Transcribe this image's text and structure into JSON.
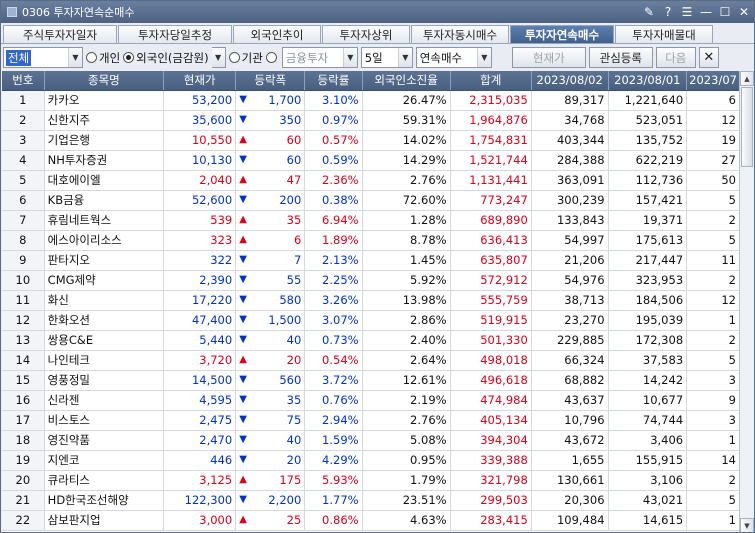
{
  "window": {
    "title": "0306 투자자연속순매수",
    "buttons": [
      "✎",
      "?",
      "☰",
      "—",
      "☐",
      "✕"
    ]
  },
  "tabs": [
    {
      "label": "주식투자자일자",
      "w": 114
    },
    {
      "label": "투자자당일추정",
      "w": 114
    },
    {
      "label": "외국인추이",
      "w": 88
    },
    {
      "label": "투자자상위",
      "w": 88
    },
    {
      "label": "투자자동시매수",
      "w": 98
    },
    {
      "label": "투자자연속매수",
      "w": 104,
      "active": true
    },
    {
      "label": "투자자매물대",
      "w": 98
    }
  ],
  "toolbar": {
    "market": "전체",
    "radio_individual": "개인",
    "radio_foreign": "외국인(금감원)",
    "radio_institution": "기관",
    "institution_type": "금융투자",
    "period": "5일",
    "mode": "연속매수",
    "current_price_btn": "현재가",
    "watchlist_btn": "관심등록",
    "next_btn": "다음",
    "close_icon": "✕"
  },
  "columns": [
    "번호",
    "종목명",
    "현재가",
    "등락폭",
    "등락률",
    "외국인소진율",
    "합계",
    "2023/08/02",
    "2023/08/01",
    "2023/07"
  ],
  "rows": [
    {
      "no": "1",
      "name": "카카오",
      "price": "53,200",
      "dir": "down",
      "chg": "1,700",
      "rate": "3.10%",
      "exh": "26.47%",
      "sum": "2,315,035",
      "d1": "89,317",
      "d2": "1,221,640",
      "d3": "6"
    },
    {
      "no": "2",
      "name": "신한지주",
      "price": "35,600",
      "dir": "down",
      "chg": "350",
      "rate": "0.97%",
      "exh": "59.31%",
      "sum": "1,964,876",
      "d1": "34,768",
      "d2": "523,051",
      "d3": "12"
    },
    {
      "no": "3",
      "name": "기업은행",
      "price": "10,550",
      "dir": "up",
      "chg": "60",
      "rate": "0.57%",
      "exh": "14.02%",
      "sum": "1,754,831",
      "d1": "403,344",
      "d2": "135,752",
      "d3": "19"
    },
    {
      "no": "4",
      "name": "NH투자증권",
      "price": "10,130",
      "dir": "down",
      "chg": "60",
      "rate": "0.59%",
      "exh": "14.29%",
      "sum": "1,521,744",
      "d1": "284,388",
      "d2": "622,219",
      "d3": "27"
    },
    {
      "no": "5",
      "name": "대호에이엘",
      "price": "2,040",
      "dir": "up",
      "chg": "47",
      "rate": "2.36%",
      "exh": "2.76%",
      "sum": "1,131,441",
      "d1": "363,091",
      "d2": "112,736",
      "d3": "50"
    },
    {
      "no": "6",
      "name": "KB금융",
      "price": "52,600",
      "dir": "down",
      "chg": "200",
      "rate": "0.38%",
      "exh": "72.60%",
      "sum": "773,247",
      "d1": "300,239",
      "d2": "157,421",
      "d3": "5"
    },
    {
      "no": "7",
      "name": "휴림네트웍스",
      "price": "539",
      "dir": "up",
      "chg": "35",
      "rate": "6.94%",
      "exh": "1.28%",
      "sum": "689,890",
      "d1": "133,843",
      "d2": "19,371",
      "d3": "2"
    },
    {
      "no": "8",
      "name": "에스아이리소스",
      "price": "323",
      "dir": "up",
      "chg": "6",
      "rate": "1.89%",
      "exh": "8.78%",
      "sum": "636,413",
      "d1": "54,997",
      "d2": "175,613",
      "d3": "5"
    },
    {
      "no": "9",
      "name": "판타지오",
      "price": "322",
      "dir": "down",
      "chg": "7",
      "rate": "2.13%",
      "exh": "1.45%",
      "sum": "635,807",
      "d1": "21,206",
      "d2": "217,447",
      "d3": "11"
    },
    {
      "no": "10",
      "name": "CMG제약",
      "price": "2,390",
      "dir": "down",
      "chg": "55",
      "rate": "2.25%",
      "exh": "5.92%",
      "sum": "572,912",
      "d1": "54,976",
      "d2": "323,953",
      "d3": "2"
    },
    {
      "no": "11",
      "name": "화신",
      "price": "17,220",
      "dir": "down",
      "chg": "580",
      "rate": "3.26%",
      "exh": "13.98%",
      "sum": "555,759",
      "d1": "38,713",
      "d2": "184,506",
      "d3": "12"
    },
    {
      "no": "12",
      "name": "한화오션",
      "price": "47,400",
      "dir": "down",
      "chg": "1,500",
      "rate": "3.07%",
      "exh": "2.86%",
      "sum": "519,915",
      "d1": "23,270",
      "d2": "195,039",
      "d3": "1"
    },
    {
      "no": "13",
      "name": "쌍용C&E",
      "price": "5,440",
      "dir": "down",
      "chg": "40",
      "rate": "0.73%",
      "exh": "2.40%",
      "sum": "501,330",
      "d1": "229,885",
      "d2": "172,308",
      "d3": "2"
    },
    {
      "no": "14",
      "name": "나인테크",
      "price": "3,720",
      "dir": "up",
      "chg": "20",
      "rate": "0.54%",
      "exh": "2.64%",
      "sum": "498,018",
      "d1": "66,324",
      "d2": "37,583",
      "d3": "5"
    },
    {
      "no": "15",
      "name": "영풍정밀",
      "price": "14,500",
      "dir": "down",
      "chg": "560",
      "rate": "3.72%",
      "exh": "12.61%",
      "sum": "496,618",
      "d1": "68,882",
      "d2": "14,242",
      "d3": "3"
    },
    {
      "no": "16",
      "name": "신라젠",
      "price": "4,595",
      "dir": "down",
      "chg": "35",
      "rate": "0.76%",
      "exh": "2.19%",
      "sum": "474,984",
      "d1": "43,637",
      "d2": "10,677",
      "d3": "9"
    },
    {
      "no": "17",
      "name": "비스토스",
      "price": "2,475",
      "dir": "down",
      "chg": "75",
      "rate": "2.94%",
      "exh": "2.76%",
      "sum": "405,134",
      "d1": "10,796",
      "d2": "74,744",
      "d3": "3"
    },
    {
      "no": "18",
      "name": "영진약품",
      "price": "2,470",
      "dir": "down",
      "chg": "40",
      "rate": "1.59%",
      "exh": "5.08%",
      "sum": "394,304",
      "d1": "43,672",
      "d2": "3,406",
      "d3": "1"
    },
    {
      "no": "19",
      "name": "지엔코",
      "price": "446",
      "dir": "down",
      "chg": "20",
      "rate": "4.29%",
      "exh": "0.95%",
      "sum": "339,388",
      "d1": "1,655",
      "d2": "155,915",
      "d3": "14"
    },
    {
      "no": "20",
      "name": "큐라티스",
      "price": "3,125",
      "dir": "up",
      "chg": "175",
      "rate": "5.93%",
      "exh": "1.79%",
      "sum": "321,798",
      "d1": "130,661",
      "d2": "3,106",
      "d3": "2"
    },
    {
      "no": "21",
      "name": "HD한국조선해양",
      "price": "122,300",
      "dir": "down",
      "chg": "2,200",
      "rate": "1.77%",
      "exh": "23.51%",
      "sum": "299,503",
      "d1": "20,306",
      "d2": "43,021",
      "d3": "5"
    },
    {
      "no": "22",
      "name": "삼보판지업",
      "price": "3,000",
      "dir": "up",
      "chg": "25",
      "rate": "0.86%",
      "exh": "4.63%",
      "sum": "283,415",
      "d1": "109,484",
      "d2": "14,615",
      "d3": "1"
    }
  ],
  "colors": {
    "up": "#d8001a",
    "down": "#0032c8",
    "header": "#4f6586",
    "active_tab": "#4a6a9a"
  }
}
